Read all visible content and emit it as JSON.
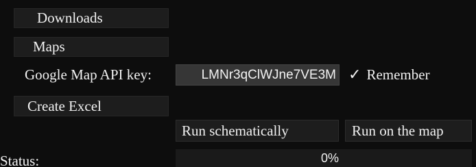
{
  "nav": {
    "downloads_label": "Downloads",
    "maps_label": "Maps"
  },
  "api_key": {
    "label": "Google Map API key:",
    "value": "LMNr3qClWJne7VE3M"
  },
  "remember": {
    "checked": true,
    "icon": "check-icon",
    "label": "Remember"
  },
  "actions": {
    "create_excel_label": "Create Excel",
    "run_schematic_label": "Run schematically",
    "run_map_label": "Run on the map"
  },
  "status": {
    "label": "Status:",
    "progress_percent": 0,
    "progress_text": "0%"
  },
  "colors": {
    "background": "#0d0d0d",
    "button": "#1d1d1d",
    "input": "#363636",
    "text": "#f2f2f2"
  }
}
